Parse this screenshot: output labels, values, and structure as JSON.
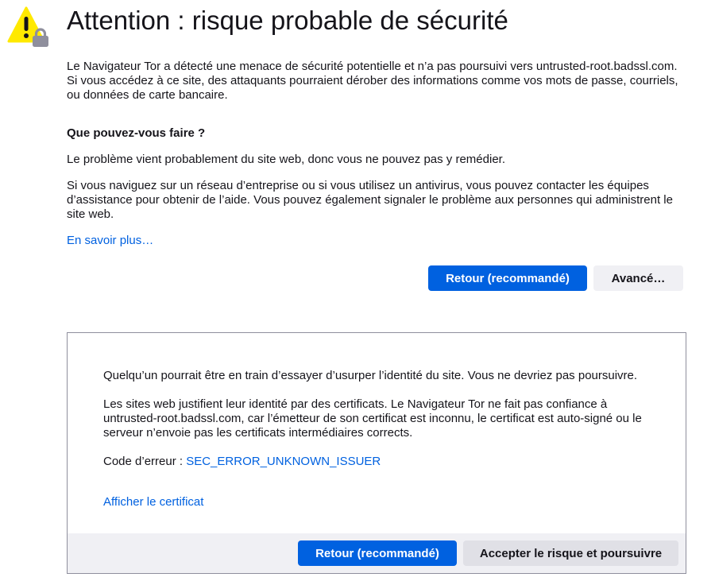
{
  "page": {
    "title": "Attention : risque probable de sécurité",
    "icon": "warning-lock-icon"
  },
  "intro": "Le Navigateur Tor a détecté une menace de sécurité potentielle et n’a pas poursuivi vers untrusted-root.badssl.com. Si vous accédez à ce site, des attaquants pourraient dérober des informations comme vos mots de passe, courriels, ou données de carte bancaire.",
  "what_can_you_do": {
    "heading": "Que pouvez-vous faire ?",
    "paragraph1": "Le problème vient probablement du site web, donc vous ne pouvez pas y remédier.",
    "paragraph2": "Si vous naviguez sur un réseau d’entreprise ou si vous utilisez un antivirus, vous pouvez contacter les équipes d’assistance pour obtenir de l’aide. Vous pouvez également signaler le problème aux personnes qui administrent le site web.",
    "learn_more": "En savoir plus…"
  },
  "actions": {
    "back_label": "Retour (recommandé)",
    "advanced_label": "Avancé…"
  },
  "advanced_panel": {
    "paragraph1": "Quelqu’un pourrait être en train d’essayer d’usurper l’identité du site. Vous ne devriez pas poursuivre.",
    "paragraph2": "Les sites web justifient leur identité par des certificats. Le Navigateur Tor ne fait pas confiance à untrusted-root.badssl.com, car l’émetteur de son certificat est inconnu, le certificat est auto-signé ou le serveur n’envoie pas les certificats intermédiaires corrects.",
    "error_code_label": "Code d’erreur : ",
    "error_code": "SEC_ERROR_UNKNOWN_ISSUER",
    "view_certificate": "Afficher le certificat",
    "back_label": "Retour (recommandé)",
    "accept_label": "Accepter le risque et poursuivre"
  },
  "colors": {
    "accent": "#0061e0",
    "warning_yellow": "#ffe900",
    "lock_gray": "#8f8f9d",
    "text": "#15141a",
    "button_secondary": "#f0f0f4"
  }
}
